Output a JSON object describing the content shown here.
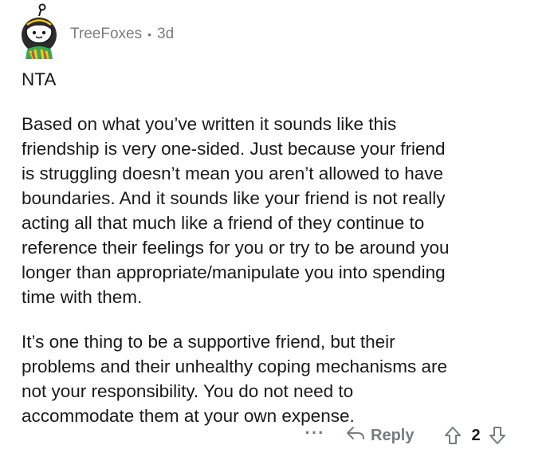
{
  "comment": {
    "author": "TreeFoxes",
    "separator": "•",
    "age": "3d",
    "verdict": "NTA",
    "paragraph_1": "Based on what you’ve written it sounds like this\nfriendship is very one-sided. Just because your friend\nis struggling doesn’t mean you aren’t allowed to have\nboundaries. And it sounds like your friend is not really\nacting all that much like a friend of they continue to\nreference their feelings for you or try to be around you\nlonger than appropriate/manipulate you into spending\ntime with them.",
    "paragraph_2": "It’s one thing to be a supportive friend, but their\nproblems and their unhealthy coping mechanisms are\nnot your responsibility. You do not need to\naccommodate them at your own expense."
  },
  "actions": {
    "more_label": "···",
    "reply_label": "Reply",
    "score": "2"
  },
  "icons": {
    "avatar": "snoo-avatar-icon",
    "reply": "reply-arrow-icon",
    "upvote": "upvote-arrow-icon",
    "downvote": "downvote-arrow-icon"
  },
  "colors": {
    "text": "#1a1a1b",
    "meta": "#7c7c7c",
    "action": "#787c7e"
  }
}
